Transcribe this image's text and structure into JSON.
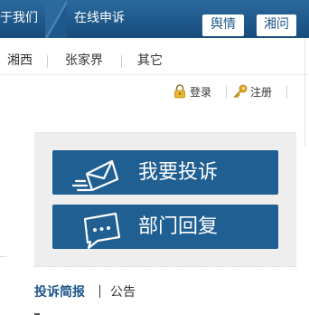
{
  "nav": {
    "about": "于我们",
    "online_complaint": "在线申诉",
    "public_opinion": "舆情",
    "consult": "湘问"
  },
  "regions": [
    "湘西",
    "张家界",
    "其它"
  ],
  "account": {
    "login": "登录",
    "register": "注册"
  },
  "actions": {
    "complain": "我要投诉",
    "dept_reply": "部门回复"
  },
  "tabs": {
    "brief": "投诉简报",
    "notice": "公告"
  },
  "colors": {
    "nav_blue": "#1e578a",
    "button_blue": "#1f5f92",
    "panel_gray": "#eeeeee",
    "key_icon": "#e2a824"
  }
}
